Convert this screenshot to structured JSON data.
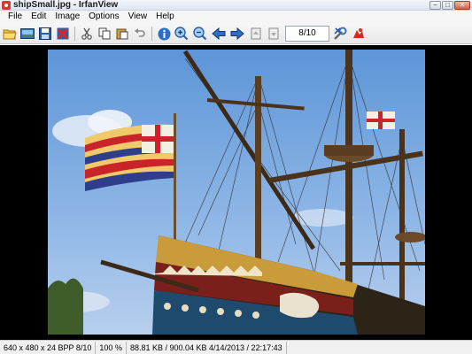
{
  "window": {
    "title": "shipSmall.jpg - IrfanView",
    "buttons": {
      "minimize": "−",
      "maximize": "□",
      "close": "✕"
    }
  },
  "menu": [
    "File",
    "Edit",
    "Image",
    "Options",
    "View",
    "Help"
  ],
  "toolbar": {
    "buttons": [
      {
        "name": "open-folder-icon"
      },
      {
        "name": "slideshow-icon"
      },
      {
        "name": "save-icon"
      },
      {
        "name": "delete-icon"
      },
      {
        "name": "cut-icon"
      },
      {
        "name": "copy-icon"
      },
      {
        "name": "paste-icon"
      },
      {
        "name": "undo-icon"
      },
      {
        "name": "info-icon"
      },
      {
        "name": "zoom-in-icon"
      },
      {
        "name": "zoom-out-icon"
      },
      {
        "name": "previous-icon"
      },
      {
        "name": "next-icon"
      },
      {
        "name": "first-page-icon"
      },
      {
        "name": "last-page-icon"
      },
      {
        "name": "settings-icon"
      },
      {
        "name": "irfanview-icon"
      }
    ],
    "page_indicator": "8/10"
  },
  "image": {
    "subject": "tall ship with flags against blue sky"
  },
  "status": {
    "dimensions": "640 x 480 x 24 BPP 8/10",
    "zoom": "100 %",
    "filesize": "88.81 KB / 900.04 KB 4/14/2013 / 22:17:43"
  }
}
